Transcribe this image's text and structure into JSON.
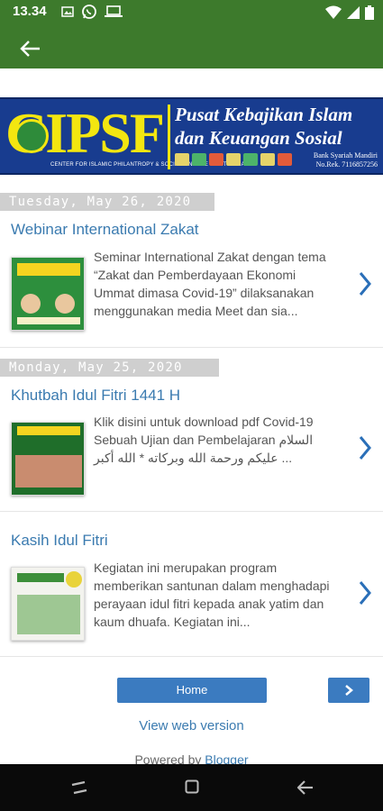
{
  "status": {
    "time": "13.34"
  },
  "banner": {
    "brand": "CIPSF",
    "sub": "CENTER FOR ISLAMIC PHILANTROPY & SOCIAL FINANCE UNTIT DUMAI",
    "tagline1": "Pusat Kebajikan Islam",
    "tagline2": "dan Keuangan Sosial",
    "bank1": "Bank Syariah Mandiri",
    "bank2": "No.Rek. 7116857256"
  },
  "posts": [
    {
      "date": "Tuesday, May 26, 2020",
      "title": "Webinar International Zakat",
      "snippet": "Seminar International Zakat dengan tema “Zakat dan Pemberdayaan Ekonomi Ummat dimasa Covid-19” dilaksanakan menggunakan media Meet dan sia..."
    },
    {
      "date": "Monday, May 25, 2020",
      "title": "Khutbah Idul Fitri 1441 H",
      "snippet": "Klik disini untuk download pdf Covid-19 Sebuah Ujian dan Pembelajaran السلام عليكم ورحمة الله وبركاته * الله أكبر ..."
    },
    {
      "date": "",
      "title": "Kasih Idul Fitri",
      "snippet": "Kegiatan ini merupakan program memberikan santunan dalam menghadapi perayaan idul fitri kepada anak yatim dan kaum dhuafa. Kegiatan ini..."
    }
  ],
  "footer": {
    "home_label": "Home",
    "web_version": "View web version",
    "powered_prefix": "Powered by ",
    "powered_link": "Blogger"
  },
  "colors": {
    "appbar": "#3d7a2c",
    "link": "#3b7bb0",
    "button": "#3b7bc0",
    "banner": "#183c8f"
  },
  "icons": [
    "back-arrow-icon",
    "chevron-right-icon",
    "wifi-icon",
    "signal-icon",
    "battery-icon",
    "recents-icon",
    "home-nav-icon",
    "back-nav-icon"
  ]
}
